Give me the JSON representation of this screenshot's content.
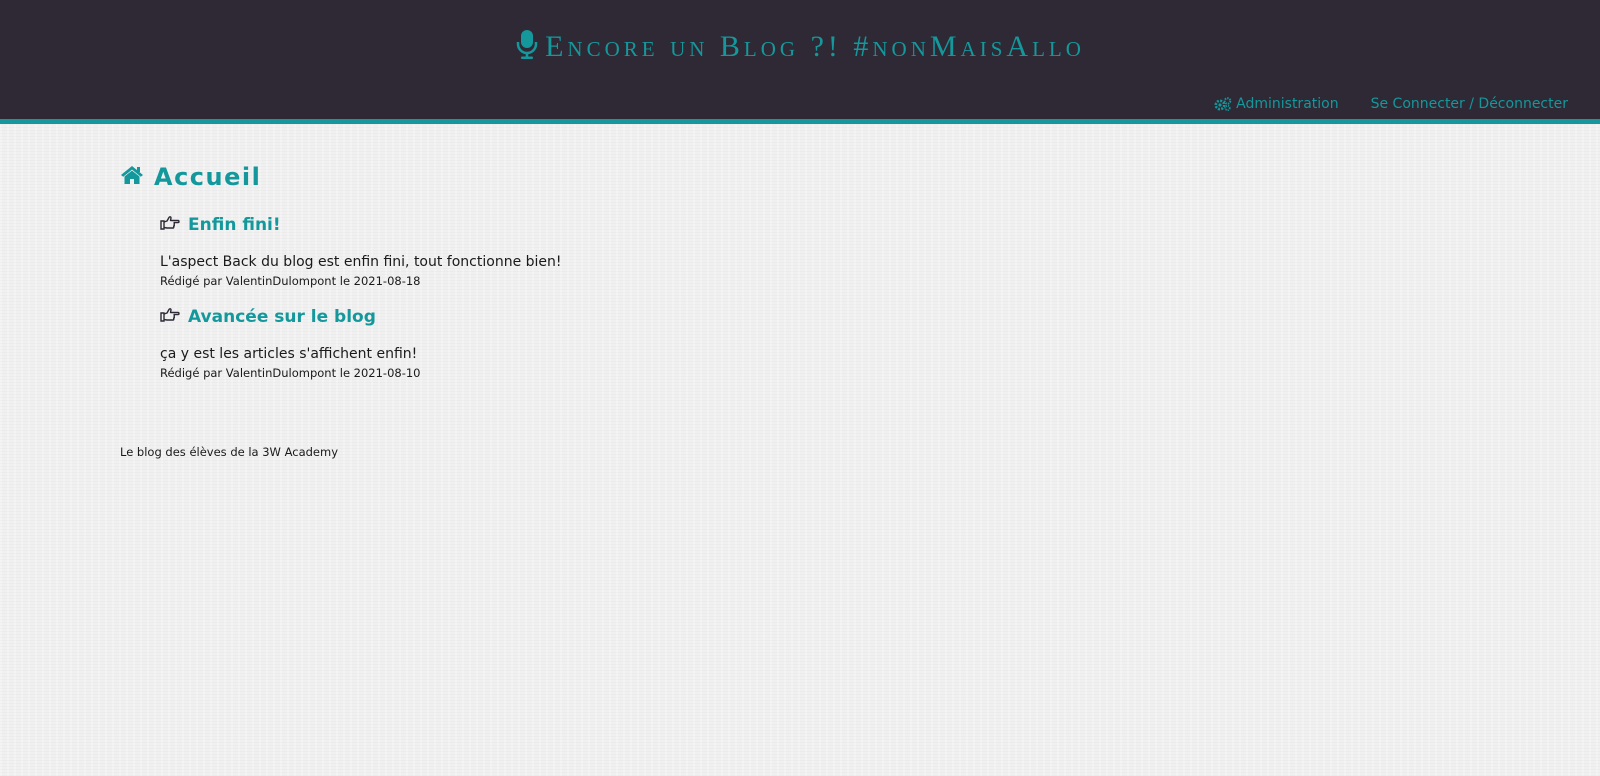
{
  "header": {
    "title": "Encore un Blog ?! #nonMaisAllo",
    "title_icon": "microphone-icon",
    "nav": {
      "admin_label": "Administration",
      "admin_icon": "gears-icon",
      "login_label": "Se Connecter / Déconnecter"
    }
  },
  "main": {
    "heading": "Accueil",
    "heading_icon": "home-icon",
    "articles": [
      {
        "title": "Enfin fini!",
        "icon": "hand-pointing-right-icon",
        "body": "L'aspect Back du blog est enfin fini, tout fonctionne bien!",
        "meta": "Rédigé par ValentinDulompont le 2021-08-18"
      },
      {
        "title": "Avancée sur le blog",
        "icon": "hand-pointing-right-icon",
        "body": "ça y est les articles s'affichent enfin!",
        "meta": "Rédigé par ValentinDulompont le 2021-08-10"
      }
    ]
  },
  "footer": {
    "text": "Le blog des élèves de la 3W Academy"
  },
  "colors": {
    "accent": "#14989c",
    "header_bg": "#2e2934",
    "page_bg": "#f0f0f0",
    "text": "#1a1a1a"
  }
}
